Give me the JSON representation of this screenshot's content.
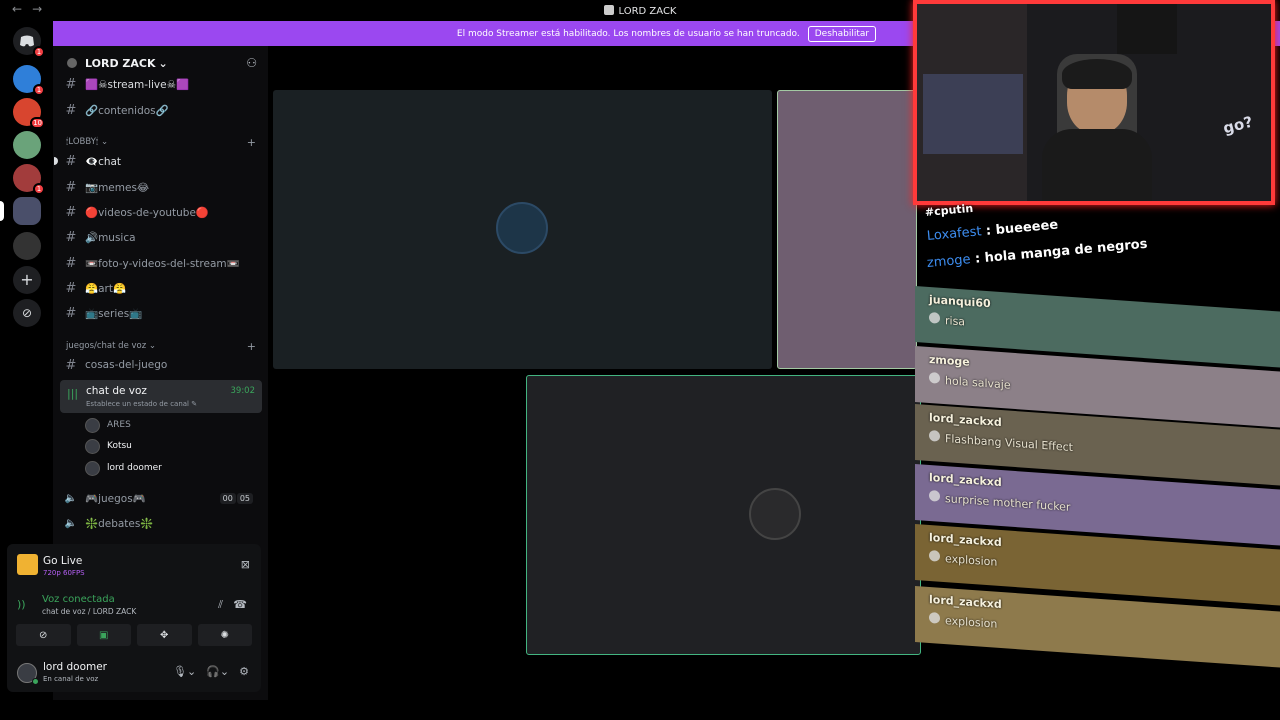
{
  "titlebar": {
    "title": "LORD ZACK",
    "back": "←",
    "forward": "→"
  },
  "banner": {
    "text": "El modo Streamer está habilitado. Los nombres de usuario se han truncado.",
    "button": "Deshabilitar",
    "close": "✕"
  },
  "guilds": [
    {
      "badge": ""
    },
    {
      "badge": "1"
    },
    {
      "badge": "10"
    },
    {
      "badge": ""
    },
    {
      "badge": "1"
    },
    {
      "badge": ""
    },
    {
      "badge": ""
    }
  ],
  "server": {
    "name": "LORD ZACK",
    "chevron": "⌄"
  },
  "channels": {
    "stream_live": "🟪☠stream-live☠🟪",
    "contenidos": "🔗contenidos🔗",
    "cat_lobby": "🕯LOBBY🕯 ⌄",
    "chat": "👁‍🗨chat",
    "memes": "📷memes😂",
    "videos_youtube": "🔴videos-de-youtube🔴",
    "musica": "🔊musica",
    "foto_videos": "📼foto-y-videos-del-stream📼",
    "art": "😤art😤",
    "series": "📺series📺",
    "cat_juegos": "juegos/chat de voz ⌄",
    "cosas_juego": "cosas-del-juego",
    "voice_active": {
      "name": "chat de voz",
      "status": "Establece un estado de canal ✎",
      "time": "39:02"
    },
    "voice_users": [
      "ARES",
      "Kotsu",
      "lord doomer"
    ],
    "juegos": "🎮juegos🎮",
    "juegos_count_a": "00",
    "juegos_count_b": "05",
    "debates": "❇️debates❇️"
  },
  "panel": {
    "golive_title": "Go Live",
    "golive_quality": "720p 60FPS",
    "vc_title": "Voz conectada",
    "vc_sub": "chat de voz / LORD ZACK",
    "user_name": "lord doomer",
    "user_status": "En canal de voz"
  },
  "overlay_chat": {
    "partial": "#cputin",
    "lines": [
      {
        "user": "Loxafest",
        "sep": " : ",
        "text": "bueeeee"
      },
      {
        "user": "zmoge",
        "sep": " : ",
        "text": "hola manga de negros"
      }
    ],
    "cards": [
      {
        "user": "juanqui60",
        "msg": "risa",
        "color": "#4c6b60"
      },
      {
        "user": "zmoge",
        "msg": "hola salvaje",
        "color": "#8c8088"
      },
      {
        "user": "lord_zackxd",
        "msg": "Flashbang Visual Effect",
        "color": "#6a6250"
      },
      {
        "user": "lord_zackxd",
        "msg": "surprise mother fucker",
        "color": "#7a6a92"
      },
      {
        "user": "lord_zackxd",
        "msg": "explosion",
        "color": "#7a6434"
      },
      {
        "user": "lord_zackxd",
        "msg": "explosion",
        "color": "#8e7a4c"
      }
    ],
    "cam_text": "go?"
  },
  "colors": {
    "accent": "#9b48f0",
    "voice_green": "#3ba55c",
    "cam_border": "#ff3a3a"
  }
}
